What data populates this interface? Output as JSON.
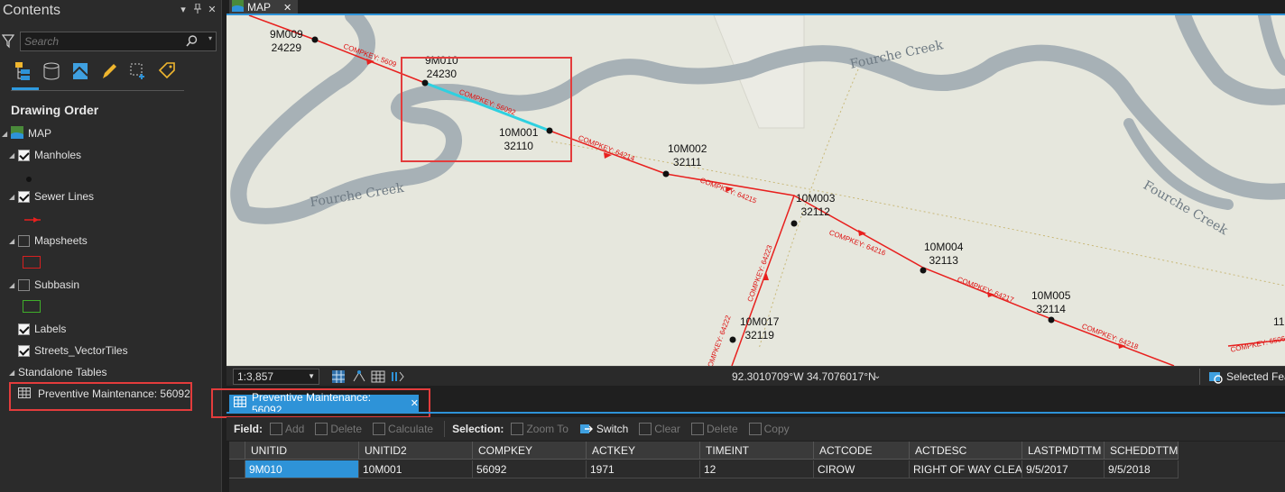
{
  "contents": {
    "title": "Contents",
    "search_placeholder": "Search",
    "drawing_order": "Drawing Order",
    "map_label": "MAP",
    "layers": [
      {
        "label": "Manholes",
        "checked": true
      },
      {
        "label": "Sewer Lines",
        "checked": true
      },
      {
        "label": "Mapsheets",
        "checked": false
      },
      {
        "label": "Subbasin",
        "checked": false
      },
      {
        "label": "Labels",
        "checked": true
      },
      {
        "label": "Streets_VectorTiles",
        "checked": true
      }
    ],
    "standalone_tables": "Standalone Tables",
    "standalone_item": "Preventive Maintenance: 56092",
    "colors": {
      "accent": "#2e93d8",
      "highlight_box": "#e33c3c"
    }
  },
  "map_tab": {
    "label": "MAP",
    "close": "✕"
  },
  "map": {
    "manholes": [
      {
        "id": "9M009",
        "num": "24229"
      },
      {
        "id": "9M010",
        "num": "24230"
      },
      {
        "id": "10M001",
        "num": "32110"
      },
      {
        "id": "10M002",
        "num": "32111"
      },
      {
        "id": "10M003",
        "num": "32112"
      },
      {
        "id": "10M004",
        "num": "32113"
      },
      {
        "id": "10M005",
        "num": "32114"
      },
      {
        "id": "10M017",
        "num": "32119"
      },
      {
        "id": "11",
        "num": ""
      }
    ],
    "compkeys": [
      "COMPKEY: 5609",
      "COMPKEY: 56092",
      "COMPKEY: 64214",
      "COMPKEY: 64215",
      "COMPKEY: 64216",
      "COMPKEY: 64217",
      "COMPKEY: 64218",
      "COMPKEY: 64223",
      "COMPKEY: 64222",
      "COMPKEY: 65066"
    ],
    "creek_labels": [
      "Fourche Creek",
      "Fourche Creek",
      "Fourche Creek"
    ],
    "colors": {
      "background": "#e6e7dd",
      "water": "#a7b1b6",
      "sewer": "#e8201e",
      "selected": "#2fd0e0"
    }
  },
  "status": {
    "scale": "1:3,857",
    "coords": "92.3010709°W 34.7076017°N",
    "selected_features": "Selected Feat"
  },
  "table_tab": {
    "label": "Preventive Maintenance: 56092",
    "close": "✕"
  },
  "toolbar": {
    "field_label": "Field:",
    "add": "Add",
    "delete": "Delete",
    "calculate": "Calculate",
    "selection_label": "Selection:",
    "zoom_to": "Zoom To",
    "switch": "Switch",
    "clear": "Clear",
    "sel_delete": "Delete",
    "copy": "Copy"
  },
  "table": {
    "columns": [
      "UNITID",
      "UNITID2",
      "COMPKEY",
      "ACTKEY",
      "TIMEINT",
      "ACTCODE",
      "ACTDESC",
      "LASTPMDTTM",
      "SCHEDDTTM"
    ],
    "rows": [
      [
        "9M010",
        "10M001",
        "56092",
        "1971",
        "12",
        "CIROW",
        "RIGHT OF WAY CLEA...",
        "9/5/2017",
        "9/5/2018"
      ]
    ]
  }
}
